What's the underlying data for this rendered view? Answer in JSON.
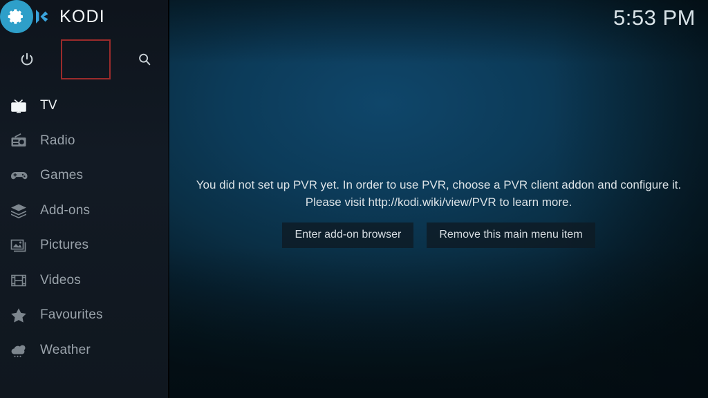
{
  "app": {
    "logo_text": "KODI",
    "logo_icon": "kodi-logo-icon"
  },
  "colors": {
    "accent_blue": "#2e9fc9",
    "highlight_box": "#9b2b2b",
    "sidebar_bg": "#121a24",
    "background_deep_teal": "#0c3b59",
    "selected_text": "#f0f4f6",
    "dim_text": "#9aa3ab"
  },
  "topbar": {
    "power_icon": "power-icon",
    "settings_icon": "gear-icon",
    "search_icon": "search-icon",
    "settings_highlighted": true
  },
  "sidebar": {
    "items": [
      {
        "label": "TV",
        "icon": "tv-icon",
        "selected": true
      },
      {
        "label": "Radio",
        "icon": "radio-icon",
        "selected": false
      },
      {
        "label": "Games",
        "icon": "gamepad-icon",
        "selected": false
      },
      {
        "label": "Add-ons",
        "icon": "addons-box-icon",
        "selected": false
      },
      {
        "label": "Pictures",
        "icon": "pictures-icon",
        "selected": false
      },
      {
        "label": "Videos",
        "icon": "videos-film-icon",
        "selected": false
      },
      {
        "label": "Favourites",
        "icon": "star-icon",
        "selected": false
      },
      {
        "label": "Weather",
        "icon": "weather-cloud-icon",
        "selected": false
      }
    ]
  },
  "main": {
    "clock": "5:53 PM",
    "message_line1": "You did not set up PVR yet. In order to use PVR, choose a PVR client addon and configure it.",
    "message_line2": "Please visit http://kodi.wiki/view/PVR to learn more.",
    "buttons": {
      "enter_addon_browser": "Enter add-on browser",
      "remove_menu_item": "Remove this main menu item"
    }
  }
}
